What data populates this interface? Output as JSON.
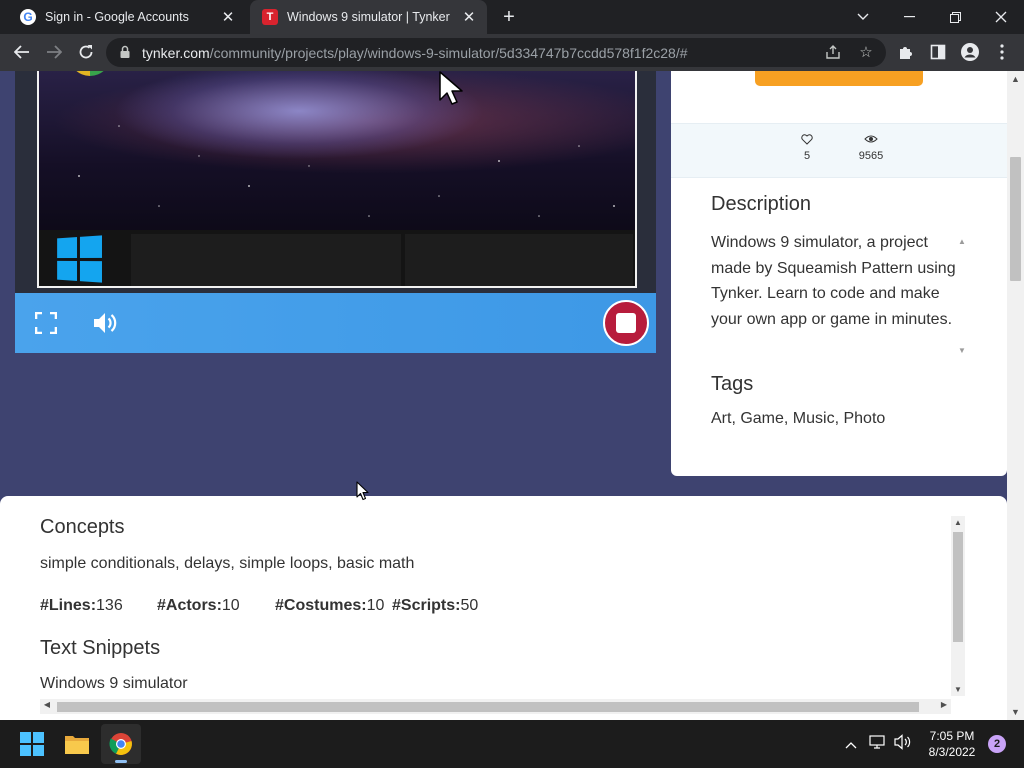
{
  "browser": {
    "tabs": [
      {
        "title": "Sign in - Google Accounts",
        "favicon": "google-icon",
        "active": false
      },
      {
        "title": "Windows 9 simulator | Tynker",
        "favicon": "tynker-icon",
        "active": true
      }
    ],
    "url_host": "tynker.com",
    "url_path": "/community/projects/play/windows-9-simulator/5d334747b7ccdd578f1f2c28/#"
  },
  "project": {
    "likes": "5",
    "views": "9565",
    "description_heading": "Description",
    "description": "Windows 9 simulator, a project made by Squeamish Pattern using Tynker. Learn to code and make your own app or game in minutes.",
    "tags_heading": "Tags",
    "tags": "Art, Game, Music, Photo"
  },
  "details": {
    "concepts_heading": "Concepts",
    "concepts": "simple conditionals, delays, simple loops, basic math",
    "metrics": [
      {
        "label": "#Lines:",
        "value": "136"
      },
      {
        "label": "#Actors:",
        "value": "10"
      },
      {
        "label": "#Costumes:",
        "value": "10"
      },
      {
        "label": "#Scripts:",
        "value": "50"
      }
    ],
    "snippets_heading": "Text Snippets",
    "snippets": "Windows 9 simulator"
  },
  "taskbar": {
    "time": "7:05 PM",
    "date": "8/3/2022",
    "notifications": "2"
  },
  "colors": {
    "page_bg": "#3e4370",
    "control_bar": "#4aa3ec",
    "stop_button": "#b71c3c",
    "orange_button": "#f7a022",
    "windows_logo": "#14a5ef"
  }
}
